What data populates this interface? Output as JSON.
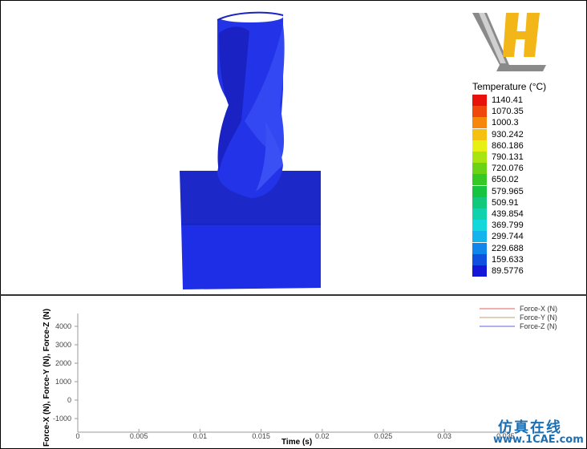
{
  "legend": {
    "title": "Temperature (°C)",
    "entries": [
      {
        "value": "1140.41",
        "color": "#e8110c"
      },
      {
        "value": "1070.35",
        "color": "#f0480c"
      },
      {
        "value": "1000.3",
        "color": "#f6860c"
      },
      {
        "value": "930.242",
        "color": "#f5c010"
      },
      {
        "value": "860.186",
        "color": "#e8ef12"
      },
      {
        "value": "790.131",
        "color": "#a8e412"
      },
      {
        "value": "720.076",
        "color": "#6ad316"
      },
      {
        "value": "650.02",
        "color": "#36c824"
      },
      {
        "value": "579.965",
        "color": "#16c440"
      },
      {
        "value": "509.91",
        "color": "#12c87a"
      },
      {
        "value": "439.854",
        "color": "#12d2ae"
      },
      {
        "value": "369.799",
        "color": "#12d8dc"
      },
      {
        "value": "299.744",
        "color": "#12b4ee"
      },
      {
        "value": "229.688",
        "color": "#1086ea"
      },
      {
        "value": "159.633",
        "color": "#1050e0"
      },
      {
        "value": "89.5776",
        "color": "#1416d8"
      }
    ]
  },
  "plot": {
    "y_axis_title": "Force-X (N), Force-Y (N), Force-Z (N)",
    "x_axis_title": "Time (s)",
    "y_ticks": [
      "4000",
      "3000",
      "2000",
      "1000",
      "0",
      "-1000"
    ],
    "x_ticks": [
      "0",
      "0.005",
      "0.01",
      "0.015",
      "0.02",
      "0.025",
      "0.03",
      "0.035"
    ],
    "series": [
      {
        "name": "Force-X (N)",
        "color": "#e06060"
      },
      {
        "name": "Force-Y (N)",
        "color": "#b8a070"
      },
      {
        "name": "Force-Z (N)",
        "color": "#6060e0"
      }
    ]
  },
  "watermark": {
    "chinese": "仿真在线",
    "url": "www.1CAE.com"
  },
  "colors": {
    "block_top": "#1c28c8",
    "block_front": "#1d2ee6",
    "drill": "#2030e0",
    "logo_gold": "#f2b619",
    "logo_gray": "#8a8a8a"
  }
}
